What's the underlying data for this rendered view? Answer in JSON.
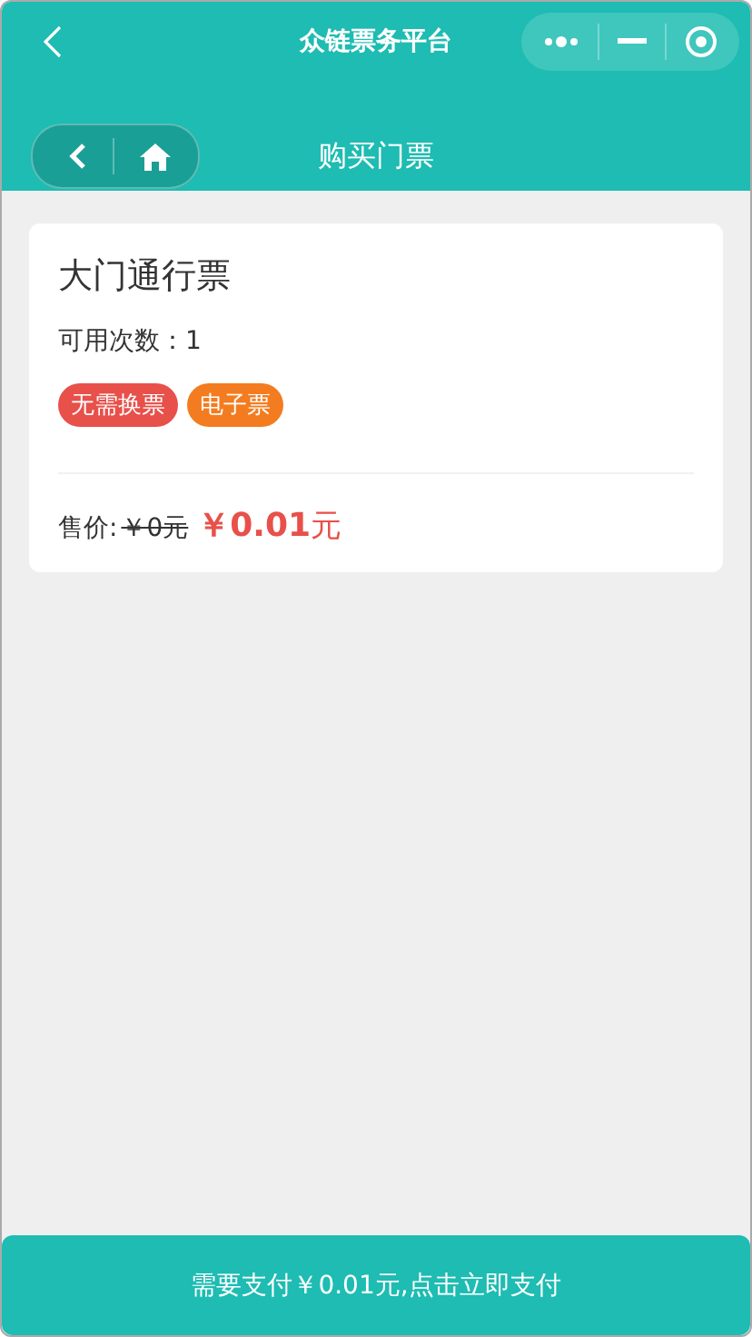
{
  "window": {
    "title": "众链票务平台"
  },
  "nav": {
    "title": "购买门票"
  },
  "ticket": {
    "name": "大门通行票",
    "uses": "可用次数：1",
    "tags": [
      {
        "label": "无需换票",
        "color": "#e8504a"
      },
      {
        "label": "电子票",
        "color": "#f37c20"
      }
    ],
    "price_label": "售价:",
    "original_price": "￥0元",
    "sale_price": "**￥0.01**元"
  },
  "pay_button": "需要支付￥0.01元,点击立即支付"
}
